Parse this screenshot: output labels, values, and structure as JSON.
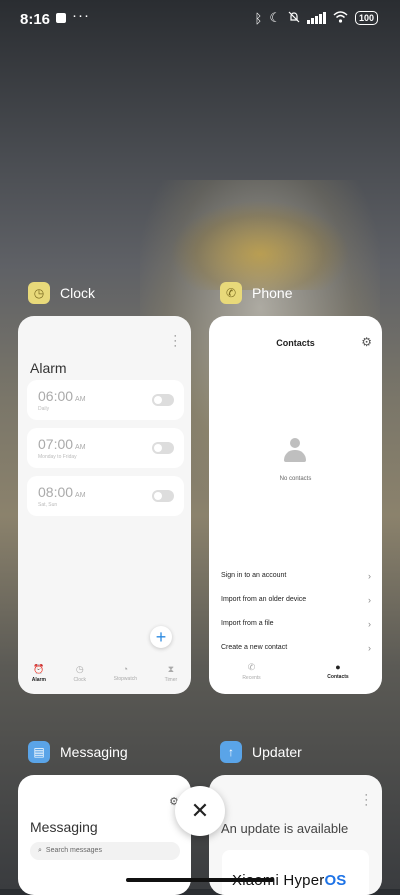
{
  "status_bar": {
    "time": "8:16",
    "dots": "···",
    "battery": "100",
    "icons": [
      "bluetooth-icon",
      "moon-icon",
      "bell-off-icon",
      "signal-icon",
      "wifi-icon",
      "battery-icon"
    ]
  },
  "recents": {
    "apps": [
      {
        "name": "Clock",
        "icon_color": "#e8d97a",
        "screen": {
          "title": "Alarm",
          "alarms": [
            {
              "time": "06:00",
              "ampm": "AM",
              "sub": "Daily"
            },
            {
              "time": "07:00",
              "ampm": "AM",
              "sub": "Monday to Friday"
            },
            {
              "time": "08:00",
              "ampm": "AM",
              "sub": "Sat, Sun"
            }
          ],
          "tabs": [
            "Alarm",
            "Clock",
            "Stopwatch",
            "Timer"
          ],
          "active_tab": "Alarm"
        }
      },
      {
        "name": "Phone",
        "icon_color": "#e8d97a",
        "screen": {
          "title": "Contacts",
          "empty_text": "No contacts",
          "menu": [
            "Sign in to an account",
            "Import from an older device",
            "Import from a file",
            "Create a new contact"
          ],
          "tabs": [
            "Recents",
            "Contacts"
          ],
          "active_tab": "Contacts"
        }
      },
      {
        "name": "Messaging",
        "icon_color": "#5aa4e8",
        "screen": {
          "title": "Messaging",
          "search_placeholder": "Search messages"
        }
      },
      {
        "name": "Updater",
        "icon_color": "#5aa4e8",
        "screen": {
          "title": "An update is available",
          "brand_main": "Xiaomi Hyper",
          "brand_os": "OS"
        }
      }
    ],
    "close_label": "✕"
  }
}
